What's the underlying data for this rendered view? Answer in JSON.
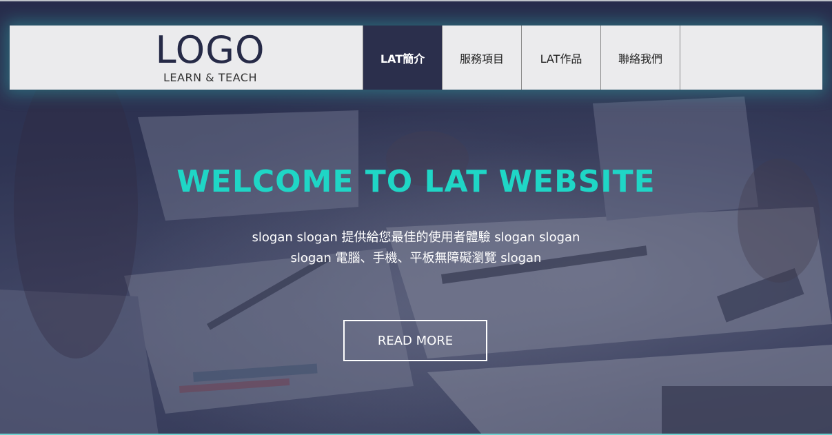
{
  "header": {
    "logo": {
      "title": "LOGO",
      "subtitle": "LEARN & TEACH"
    },
    "nav": {
      "items": [
        {
          "label": "LAT簡介",
          "active": true
        },
        {
          "label": "服務項目",
          "active": false
        },
        {
          "label": "LAT作品",
          "active": false
        },
        {
          "label": "聯絡我們",
          "active": false
        }
      ]
    }
  },
  "hero": {
    "title": "WELCOME TO LAT WEBSITE",
    "slogan_lines": [
      "slogan slogan 提供給您最佳的使用者體驗 slogan slogan",
      "slogan 電腦、手機、平板無障礙瀏覽 slogan"
    ],
    "button_label": "READ MORE"
  },
  "colors": {
    "accent": "#1fd6c6",
    "nav_active_bg": "#2b2f4c",
    "header_bg": "#ebebed",
    "overlay": "#2f3453"
  }
}
